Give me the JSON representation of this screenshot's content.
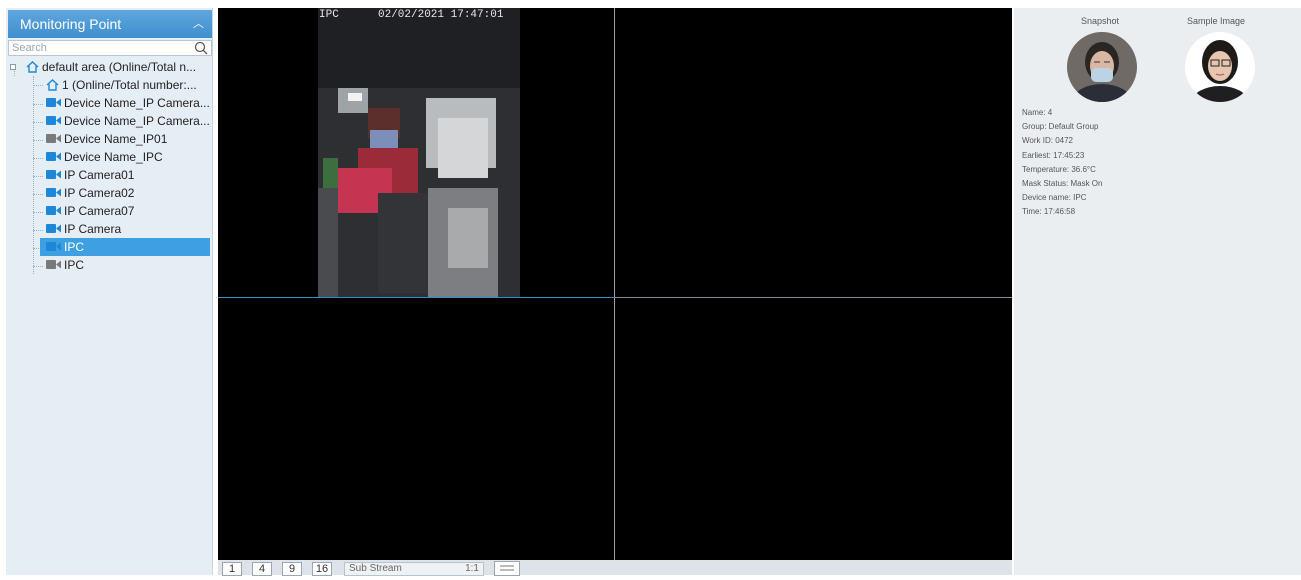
{
  "sidebar": {
    "title": "Monitoring Point",
    "search_placeholder": "Search",
    "items": [
      {
        "label": "default area (Online/Total n...",
        "icon": "home-icon"
      },
      {
        "label": "1 (Online/Total number:...",
        "icon": "home-icon"
      },
      {
        "label": "Device Name_IP Camera...",
        "icon": "camera-icon"
      },
      {
        "label": "Device Name_IP Camera...",
        "icon": "camera-icon"
      },
      {
        "label": "Device Name_IP01",
        "icon": "camera-icon"
      },
      {
        "label": "Device Name_IPC",
        "icon": "camera-icon"
      },
      {
        "label": "IP Camera01",
        "icon": "camera-icon"
      },
      {
        "label": "IP Camera02",
        "icon": "camera-icon"
      },
      {
        "label": "IP Camera07",
        "icon": "camera-icon"
      },
      {
        "label": "IP Camera",
        "icon": "camera-icon"
      },
      {
        "label": "IPC",
        "icon": "camera-icon",
        "selected": true
      },
      {
        "label": "IPC",
        "icon": "camera-icon"
      }
    ]
  },
  "video": {
    "osd_channel": "IPC",
    "osd_timestamp": "02/02/2021 17:47:01"
  },
  "toolbar": {
    "layouts": [
      "1",
      "4",
      "9",
      "16"
    ],
    "stream_label": "Sub Stream",
    "stream_ratio": "1:1"
  },
  "face_panel": {
    "snapshot_label": "Snapshot",
    "sample_label": "Sample Image",
    "details": [
      "Name: 4",
      "Group: Default Group",
      "Work ID: 0472",
      "Earliest: 17:45:23",
      "Temperature: 36.6°C",
      "Mask Status: Mask On",
      "Device name: IPC",
      "Time: 17:46:58"
    ]
  },
  "colors": {
    "header_blue": "#3f8fcf",
    "selected_row": "#3ea0e0",
    "online_camera": "#1e88d8",
    "offline_camera": "#7a7a7a"
  }
}
